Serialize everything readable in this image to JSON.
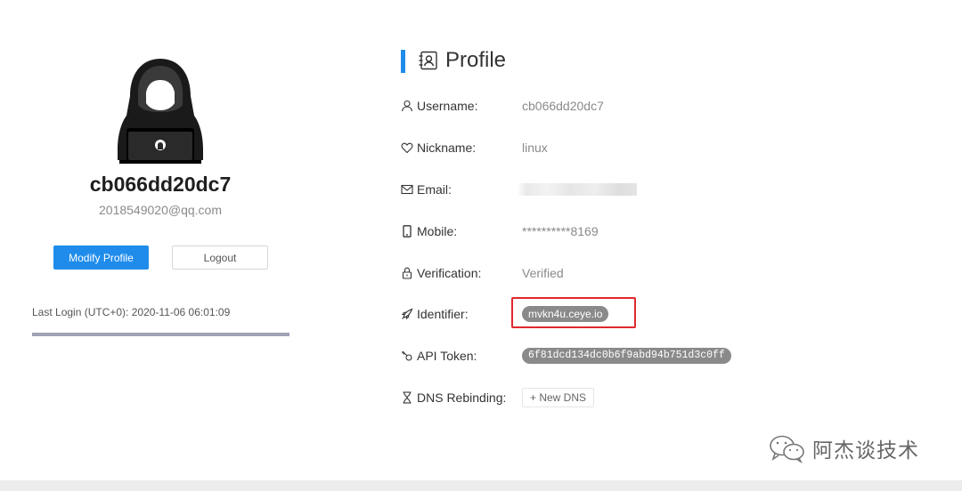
{
  "user": {
    "username_display": "cb066dd20dc7",
    "email_display": "2018549020@qq.com"
  },
  "actions": {
    "modify_profile": "Modify Profile",
    "logout": "Logout"
  },
  "last_login": "Last Login (UTC+0): 2020-11-06 06:01:09",
  "profile": {
    "title": "Profile",
    "rows": {
      "username": {
        "label": "Username:",
        "value": "cb066dd20dc7",
        "icon": "user-icon"
      },
      "nickname": {
        "label": "Nickname:",
        "value": "linux",
        "icon": "heart-icon"
      },
      "email": {
        "label": "Email:",
        "value": "",
        "icon": "mail-icon"
      },
      "mobile": {
        "label": "Mobile:",
        "value": "**********8169",
        "icon": "phone-icon"
      },
      "verification": {
        "label": "Verification:",
        "value": "Verified",
        "icon": "lock-icon"
      },
      "identifier": {
        "label": "Identifier:",
        "value": "mvkn4u.ceye.io",
        "icon": "rocket-icon"
      },
      "api_token": {
        "label": "API Token:",
        "value": "6f81dcd134dc0b6f9abd94b751d3c0ff",
        "icon": "key-icon"
      },
      "dns_rebinding": {
        "label": "DNS Rebinding:",
        "button": "+ New DNS",
        "icon": "hourglass-icon"
      }
    }
  },
  "watermark": "阿杰谈技术",
  "colors": {
    "primary": "#1f8ceb",
    "highlight": "#e0282e",
    "pill": "#8a8a8a"
  }
}
